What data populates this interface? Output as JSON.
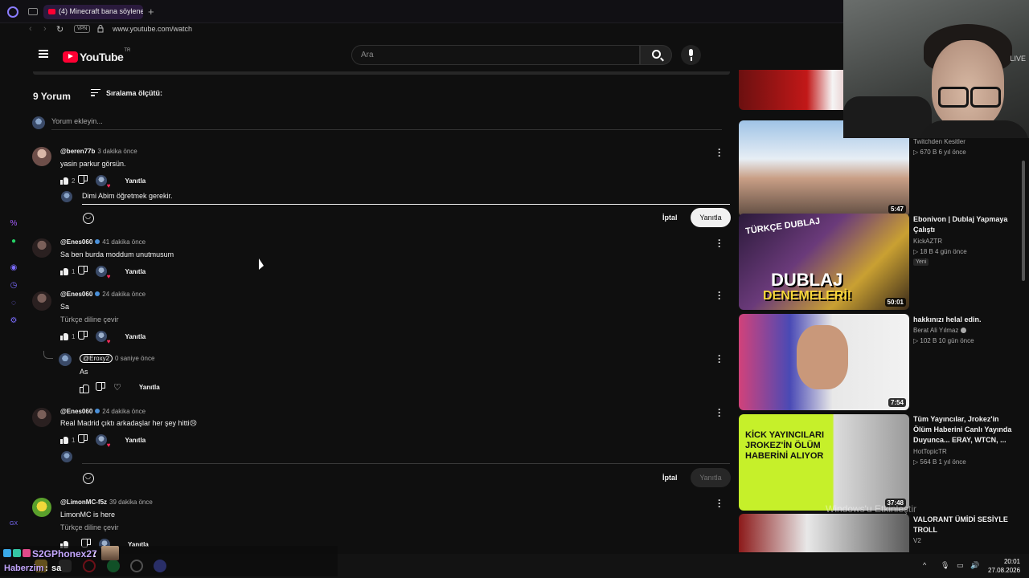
{
  "browser": {
    "tab_title": "(4) Minecraft bana söylene",
    "url": "www.youtube.com/watch",
    "vpn_label": "VPN"
  },
  "youtube": {
    "logo_text": "YouTube",
    "region": "TR",
    "search_placeholder": "Ara"
  },
  "comments": {
    "count_label": "9 Yorum",
    "sort_label": "Sıralama ölçütü:",
    "add_placeholder": "Yorum ekleyin...",
    "reply_label": "Yanıtla",
    "cancel_label": "İptal",
    "translate_label": "Türkçe diline çevir",
    "items": [
      {
        "handle": "@beren77b",
        "time": "3 dakika önce",
        "text": "yasin parkur görsün.",
        "likes": "2"
      },
      {
        "handle": "@Enes060",
        "time": "41 dakika önce",
        "text": "Sa ben burda moddum unutmusum",
        "likes": "1"
      },
      {
        "handle": "@Enes060",
        "time": "24 dakika önce",
        "text": "Sa",
        "likes": "1"
      },
      {
        "handle": "@Eroxy2",
        "time": "0 saniye önce",
        "text": "As"
      },
      {
        "handle": "@Enes060",
        "time": "24 dakika önce",
        "text": "Real Madrid çıktı arkadaşlar her şey hitti😢",
        "likes": "1"
      },
      {
        "handle": "@LimonMC-f5z",
        "time": "39 dakika önce",
        "text": "LimonMC is here"
      }
    ],
    "reply_draft": "Dimi Abim öğretmek gerekir."
  },
  "sidebar_videos": [
    {
      "channel": "Twitchden Kesitler",
      "meta": "▷ 670 B   6 yıl önce",
      "duration": "5:47"
    },
    {
      "title": "Ebonivon | Dublaj Yapmaya Çalıştı",
      "channel": "KickAZTR",
      "meta": "▷ 18 B   4 gün önce",
      "badge": "Yeni",
      "duration": "50:01",
      "thumb_text1": "TÜRKÇE DUBLAJ",
      "thumb_text2": "DUBLAJ",
      "thumb_text3": "DENEMELERİ!"
    },
    {
      "title": "hakkınızı helal edin.",
      "channel": "Berat Ali Yılmaz",
      "meta": "▷ 102 B   10 gün önce",
      "duration": "7:54"
    },
    {
      "title": "Tüm Yayıncılar, Jrokez'in Ölüm Haberini Canlı Yayında Duyunca... ERAY, WTCN, ...",
      "channel": "HotTopicTR",
      "meta": "▷ 564 B   1 yıl önce",
      "duration": "37:48",
      "thumb_text": "KİCK YAYINCILARI JROKEZ'İN ÖLÜM HABERİNİ ALIYOR"
    },
    {
      "title": "VALORANT ÜMİDİ SESİYLE TROLL",
      "channel": "V2"
    }
  ],
  "webcam": {
    "label": "LIVE"
  },
  "overlay": {
    "windows_watermark": "Windows'u Etkinleştir",
    "chat_user1": "S2GPhonex27",
    "chat_user2": "Haberzim",
    "chat_msg2": "sa"
  },
  "taskbar": {
    "time": "20:01",
    "date": "27.08.2026"
  }
}
